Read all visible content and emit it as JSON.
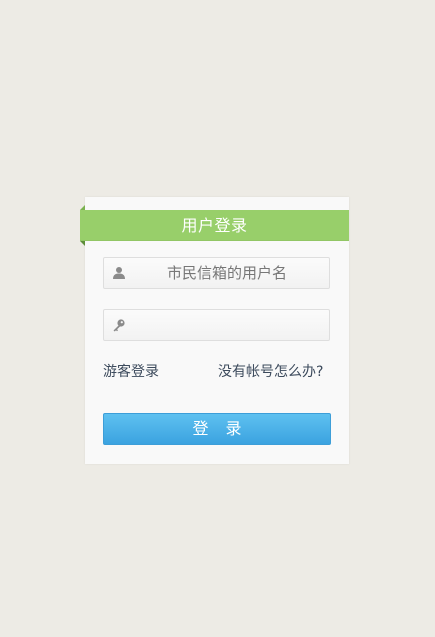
{
  "login_card": {
    "title": "用户登录",
    "username": {
      "placeholder": "市民信箱的用户名",
      "value": "",
      "icon": "user-icon"
    },
    "password": {
      "placeholder": "",
      "value": "",
      "icon": "key-icon"
    },
    "guest_login_label": "游客登录",
    "no_account_label": "没有帐号怎么办?",
    "login_button_label": "登 录"
  },
  "colors": {
    "background": "#edebe5",
    "ribbon": "#98cf6a",
    "button": "#4db3e8",
    "link": "#3c4a5c"
  }
}
